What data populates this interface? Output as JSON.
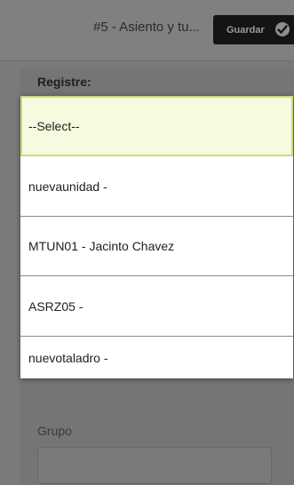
{
  "header": {
    "title": "#5 - Asiento y tu...",
    "save_label": "Guardar"
  },
  "form": {
    "title": "Registre:",
    "group_label": "Grupo",
    "group_value": ""
  },
  "dropdown": {
    "options": [
      {
        "label": "--Select--",
        "selected": true
      },
      {
        "label": "nuevaunidad -",
        "selected": false
      },
      {
        "label": "MTUN01 - Jacinto Chavez",
        "selected": false
      },
      {
        "label": "ASRZ05 -",
        "selected": false
      },
      {
        "label": "nuevotaladro -",
        "selected": false
      }
    ]
  },
  "colors": {
    "selected_background": "#f6fadf",
    "selected_border": "#c8dc7a",
    "save_button": "#141414"
  }
}
